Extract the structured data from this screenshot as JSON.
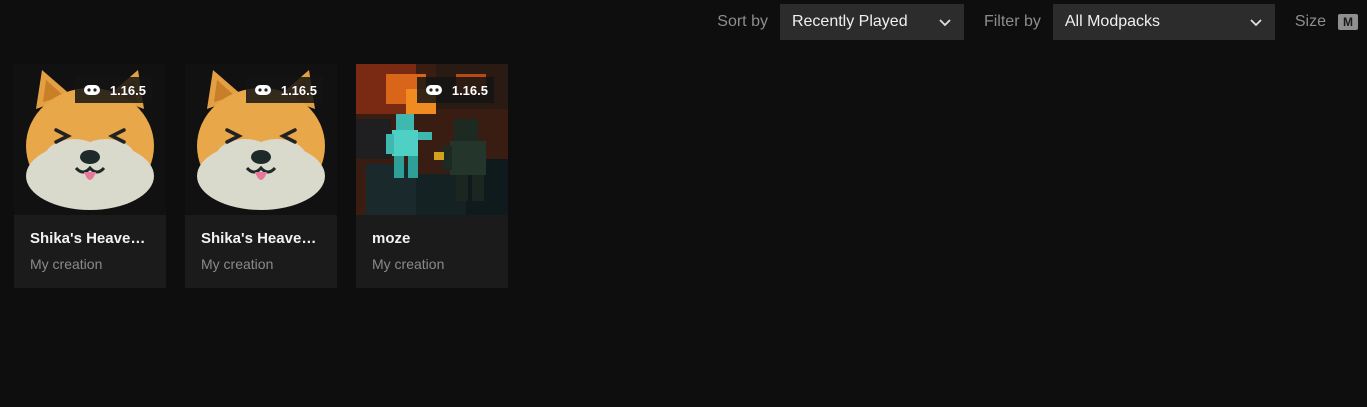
{
  "toolbar": {
    "sort_label": "Sort by",
    "sort_value": "Recently Played",
    "filter_label": "Filter by",
    "filter_value": "All Modpacks",
    "size_label": "Size",
    "size_value": "M"
  },
  "icons": {
    "dropdown": "chevron-down-icon",
    "version": "gamepad-icon"
  },
  "colors": {
    "background": "#0e0e0e",
    "card": "#1b1b1b",
    "select": "#2c2c2c"
  },
  "modpacks": [
    {
      "title": "Shika's Heaven...",
      "subtitle": "My creation",
      "version": "1.16.5",
      "thumbnail": "shiba-dog"
    },
    {
      "title": "Shika's Heaven...",
      "subtitle": "My creation",
      "version": "1.16.5",
      "thumbnail": "shiba-dog"
    },
    {
      "title": "moze",
      "subtitle": "My creation",
      "version": "1.16.5",
      "thumbnail": "minecraft-battle"
    }
  ]
}
